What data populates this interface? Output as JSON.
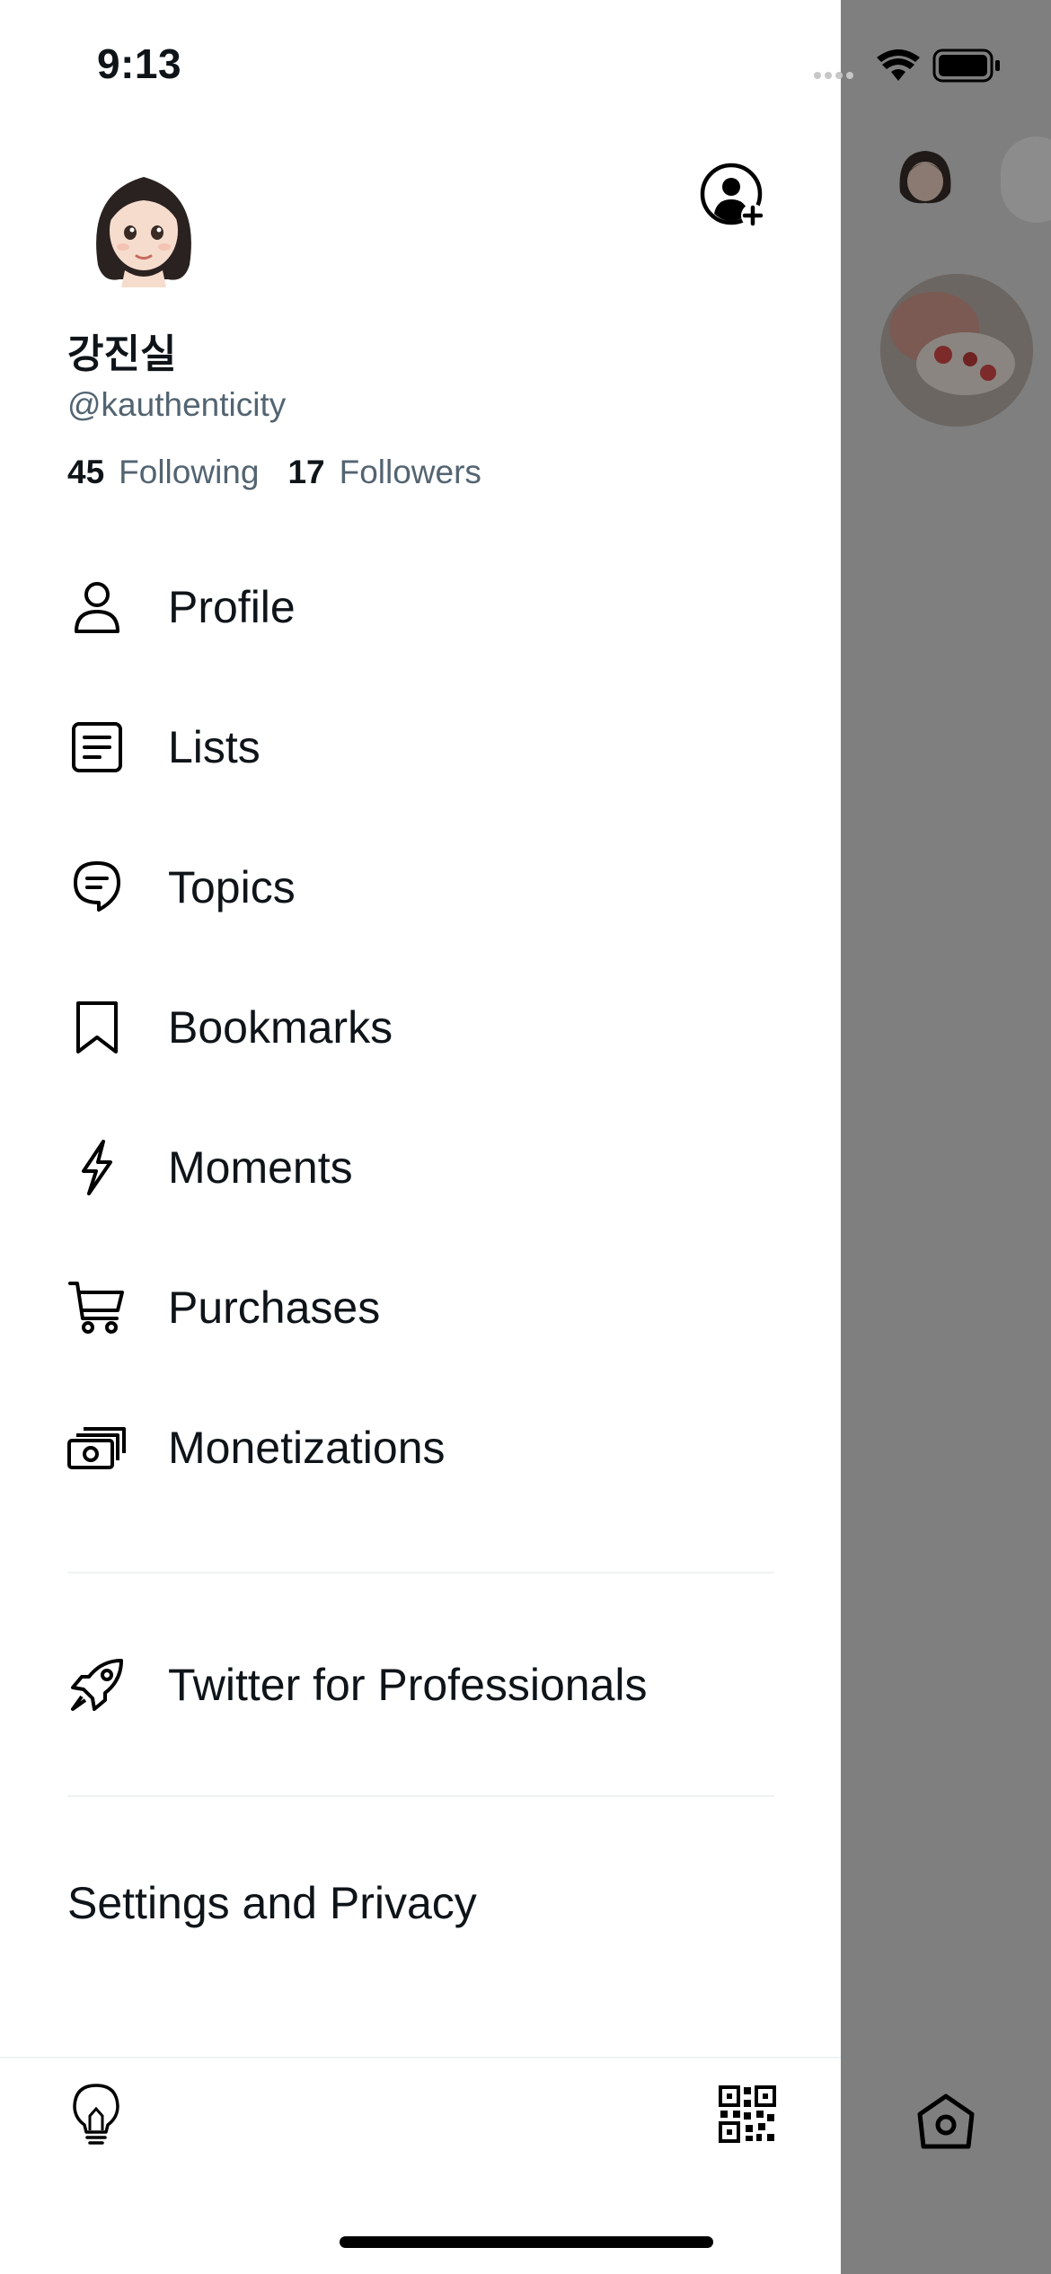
{
  "status_bar": {
    "time": "9:13"
  },
  "profile": {
    "display_name": "강진실",
    "handle": "@kauthenticity",
    "following_count": "45",
    "following_label": "Following",
    "followers_count": "17",
    "followers_label": "Followers"
  },
  "menu": [
    {
      "label": "Profile",
      "icon": "person-icon"
    },
    {
      "label": "Lists",
      "icon": "list-icon"
    },
    {
      "label": "Topics",
      "icon": "topic-bubble-icon"
    },
    {
      "label": "Bookmarks",
      "icon": "bookmark-icon"
    },
    {
      "label": "Moments",
      "icon": "lightning-icon"
    },
    {
      "label": "Purchases",
      "icon": "cart-icon"
    },
    {
      "label": "Monetizations",
      "icon": "money-icon"
    }
  ],
  "professional": {
    "label": "Twitter for Professionals",
    "icon": "rocket-icon"
  },
  "settings": {
    "label": "Settings and Privacy"
  },
  "bottom": {
    "left_icon": "lightbulb-icon",
    "right_icon": "qr-code-icon"
  },
  "colors": {
    "secondary_text": "#536471",
    "primary_text": "#0f1419",
    "overlay": "#7f7f7f"
  }
}
